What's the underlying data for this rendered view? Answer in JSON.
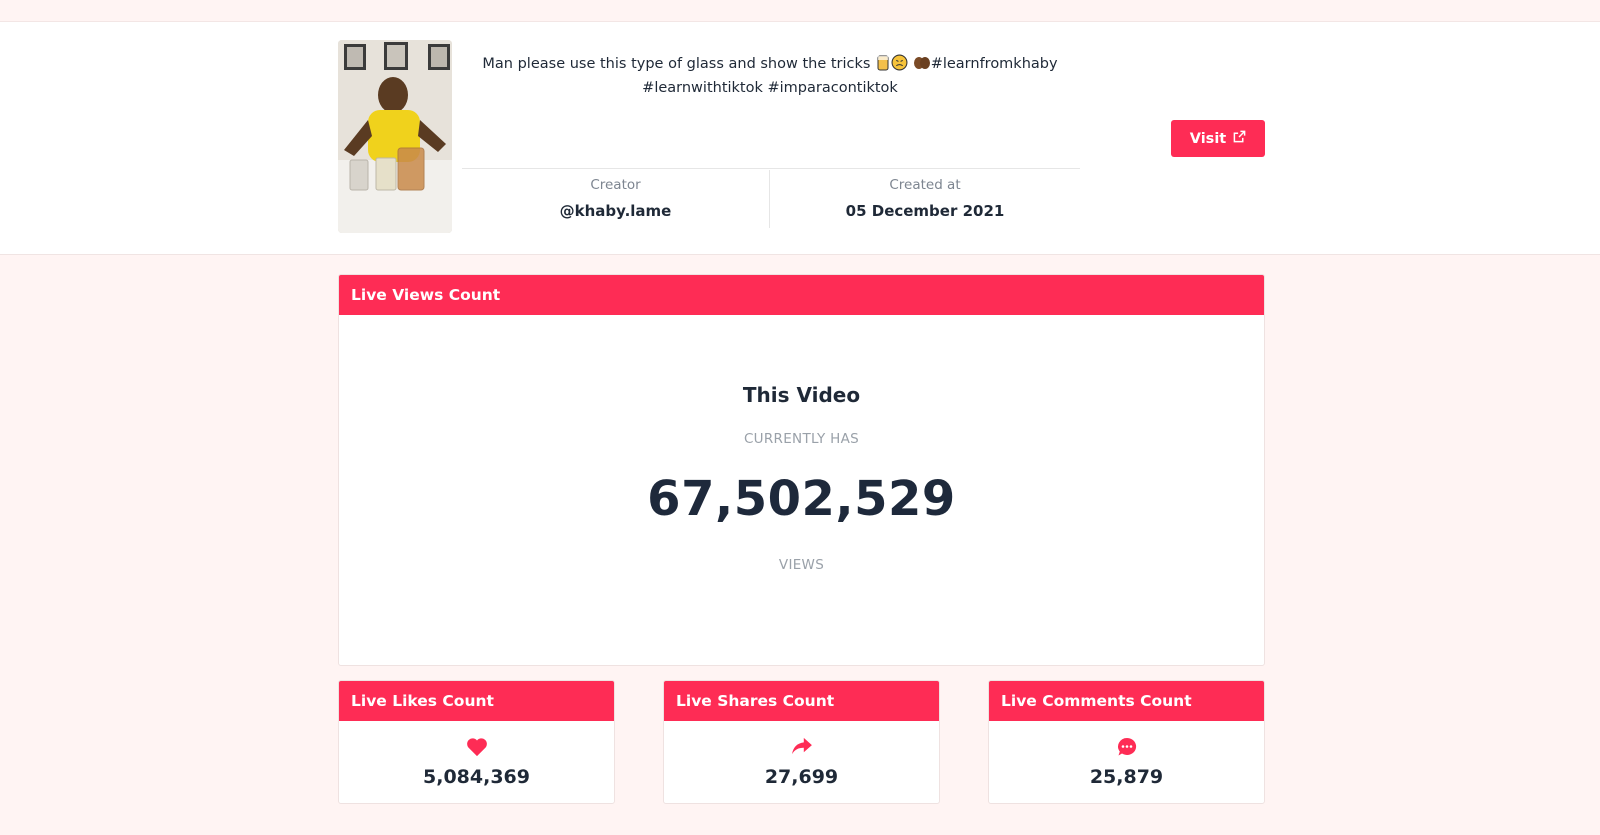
{
  "video": {
    "caption_line1": "Man please use this type of glass and show the tricks",
    "caption_hashtag1": "#learnfromkhaby",
    "caption_line2": "#learnwithtiktok #imparacontiktok",
    "creator_label": "Creator",
    "creator_value": "@khaby.lame",
    "created_label": "Created at",
    "created_value": "05 December 2021",
    "visit_label": "Visit"
  },
  "views_card": {
    "header": "Live Views Count",
    "title": "This Video",
    "subtitle": "CURRENTLY HAS",
    "count": "67,502,529",
    "unit": "VIEWS"
  },
  "stats": {
    "likes": {
      "header": "Live Likes Count",
      "count": "5,084,369",
      "icon": "heart-icon"
    },
    "shares": {
      "header": "Live Shares Count",
      "count": "27,699",
      "icon": "share-icon"
    },
    "comments": {
      "header": "Live Comments Count",
      "count": "25,879",
      "icon": "comment-icon"
    }
  },
  "colors": {
    "accent": "#fe2c55",
    "background": "#fff4f3",
    "text": "#1f2937"
  }
}
